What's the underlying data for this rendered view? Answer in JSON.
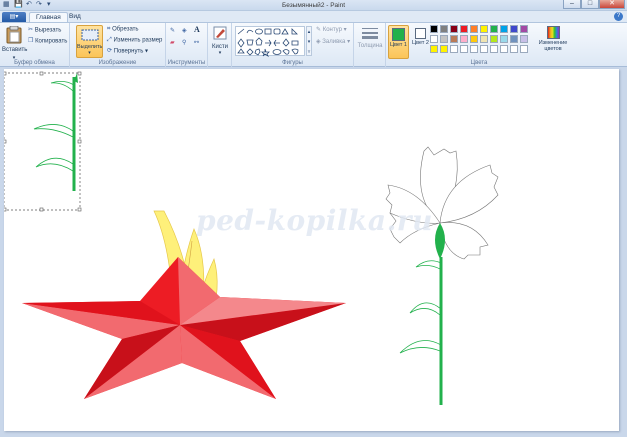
{
  "window": {
    "title": "Безымянный2 - Paint",
    "minimize": "–",
    "maximize": "□",
    "close": "✕"
  },
  "tabs": {
    "menu_label": "▾",
    "home": "Главная",
    "view": "Вид"
  },
  "clipboard": {
    "paste": "Вставить",
    "cut": "Вырезать",
    "copy": "Копировать",
    "label": "Буфер обмена"
  },
  "image": {
    "select": "Выделить",
    "crop": "Обрезать",
    "resize": "Изменить размер",
    "rotate": "Повернуть",
    "label": "Изображение"
  },
  "tools": {
    "label": "Инструменты",
    "text_tool": "A"
  },
  "brushes": {
    "label": "Кисти"
  },
  "shapes": {
    "outline": "Контур",
    "fill": "Заливка",
    "label": "Фигуры"
  },
  "size": {
    "label": "Толщина"
  },
  "colors": {
    "color1": "Цвет 1",
    "color2": "Цвет 2",
    "edit": "Изменение цветов",
    "label": "Цвета",
    "color1_value": "#21b14a",
    "color2_value": "#ffffff",
    "palette_row1": [
      "#000000",
      "#7f7f7f",
      "#880015",
      "#ed1c24",
      "#ff7f27",
      "#fff200",
      "#22b14c",
      "#00a2e8",
      "#3f48cc",
      "#a349a4"
    ],
    "palette_row2": [
      "#ffffff",
      "#c3c3c3",
      "#b97a57",
      "#ffaec9",
      "#ffc90e",
      "#efe4b0",
      "#b5e61d",
      "#99d9ea",
      "#7092be",
      "#c8bfe7"
    ],
    "palette_row3": [
      "#fff200",
      "#fff200",
      "#ffffff",
      "#ffffff",
      "#ffffff",
      "#ffffff",
      "#ffffff",
      "#ffffff",
      "#ffffff",
      "#ffffff"
    ]
  },
  "canvas": {
    "watermark": "ped-kopilka.ru"
  }
}
